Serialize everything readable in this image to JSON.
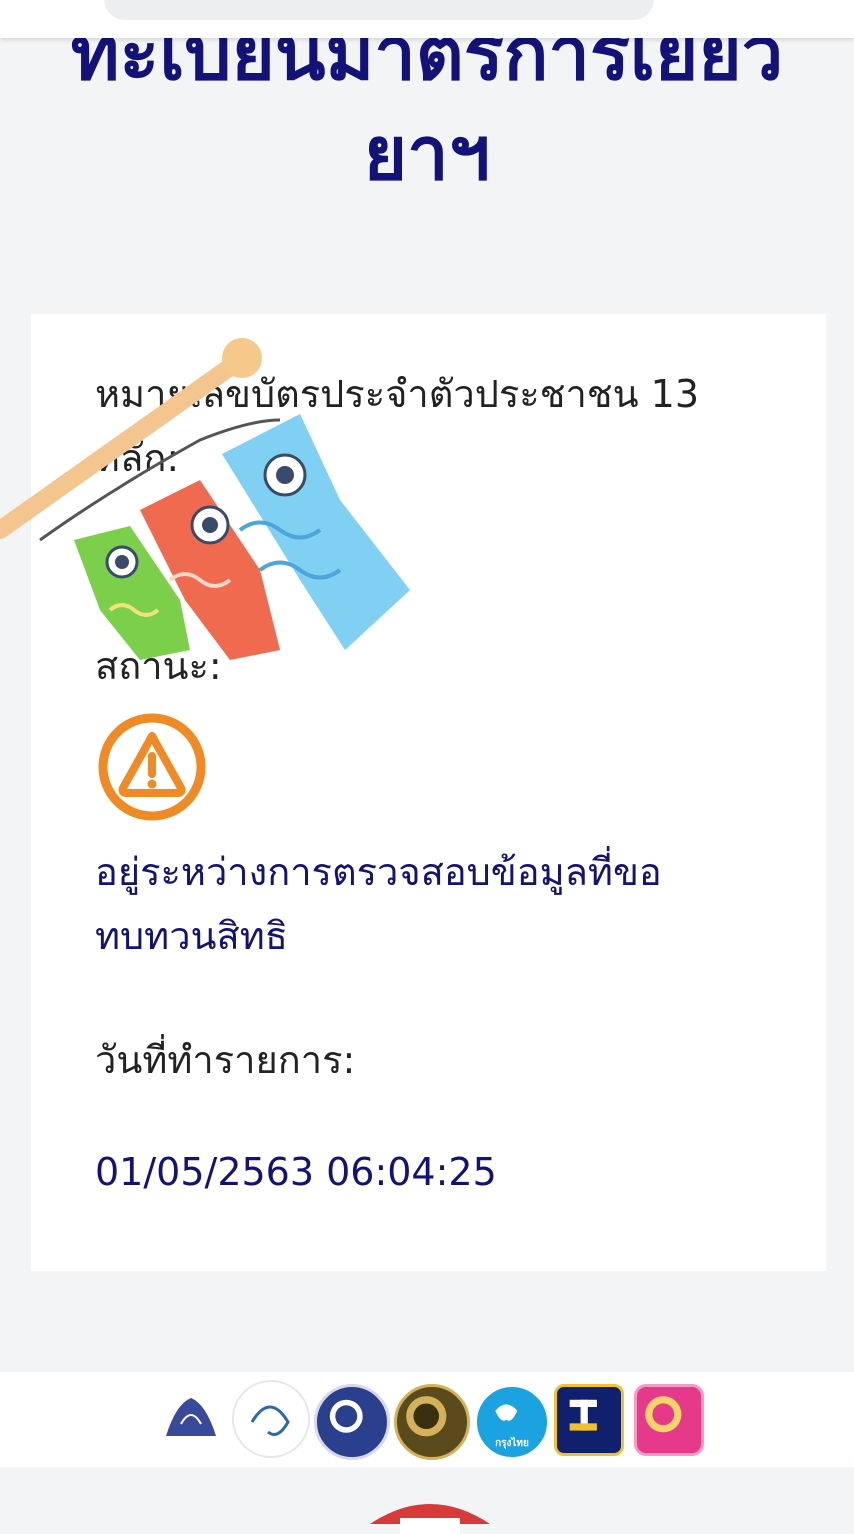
{
  "page": {
    "title_line1": "ทะเบียนมาตรการเยียว",
    "title_line2": "ยาฯ"
  },
  "record": {
    "id_label": "หมายเลขบัตรประจำตัวประชาชน 13 หลัก:",
    "id_value": "",
    "status_label": "สถานะ:",
    "status_icon": "warning-icon",
    "status_value": "อยู่ระหว่างการตรวจสอบข้อมูลที่ขอทบทวนสิทธิ",
    "date_label": "วันที่ทำรายการ:",
    "date_value": "01/05/2563 06:04:25"
  },
  "colors": {
    "title": "#12127a",
    "warning": "#f08a24",
    "ktb": "#1aa3e0",
    "gsb": "#e6398b"
  },
  "footer": {
    "ktb_text": "กรุงไทย"
  }
}
